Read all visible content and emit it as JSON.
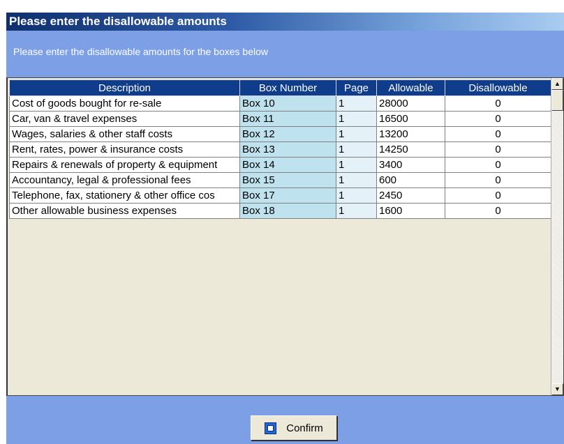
{
  "window": {
    "title": "Please enter the disallowable amounts",
    "instructions": "Please enter the disallowable amounts for the boxes below"
  },
  "table": {
    "columns": [
      "Description",
      "Box Number",
      "Page",
      "Allowable",
      "Disallowable"
    ],
    "rows": [
      {
        "description": "Cost of goods bought for re-sale",
        "box": "Box 10",
        "page": "1",
        "allowable": "28000",
        "disallowable": "0"
      },
      {
        "description": "Car, van & travel expenses",
        "box": "Box 11",
        "page": "1",
        "allowable": "16500",
        "disallowable": "0"
      },
      {
        "description": "Wages, salaries & other staff costs",
        "box": "Box 12",
        "page": "1",
        "allowable": "13200",
        "disallowable": "0"
      },
      {
        "description": "Rent, rates, power & insurance costs",
        "box": "Box 13",
        "page": "1",
        "allowable": "14250",
        "disallowable": "0"
      },
      {
        "description": "Repairs & renewals of property & equipment",
        "box": "Box 14",
        "page": "1",
        "allowable": "3400",
        "disallowable": "0"
      },
      {
        "description": "Accountancy, legal & professional fees",
        "box": "Box 15",
        "page": "1",
        "allowable": "600",
        "disallowable": "0"
      },
      {
        "description": "Telephone, fax, stationery & other office cos",
        "box": "Box 17",
        "page": "1",
        "allowable": "2450",
        "disallowable": "0"
      },
      {
        "description": "Other allowable business expenses",
        "box": "Box 18",
        "page": "1",
        "allowable": "1600",
        "disallowable": "0"
      }
    ]
  },
  "footer": {
    "confirm_label": "Confirm",
    "confirm_icon": "floppy-disk-icon"
  },
  "colors": {
    "panel": "#7c9fe6",
    "header": "#0f3d8c",
    "box_column": "#bfe3ee",
    "grid_background": "#ece9d8"
  }
}
